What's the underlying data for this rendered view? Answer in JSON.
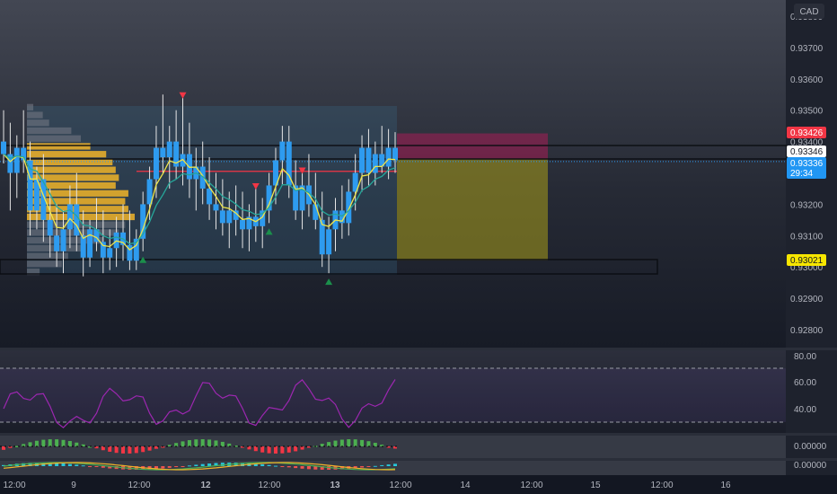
{
  "currency_badge": "CAD",
  "colors": {
    "bg_top": "#3a3e4a",
    "bg_bottom": "#131722",
    "candle": "#2e9bef",
    "wick": "#e6e6e6",
    "volume_profile": "#f0b429",
    "volume_profile_dim": "#787b86",
    "resistance_line": "#f23645",
    "short_stop_zone": "#c2185b",
    "short_target_zone": "#b5a51e",
    "ma_fast": "#f0e54a",
    "ma_slow": "#26a69a",
    "rsi_line": "#9c27b0",
    "tag_red": "#f23645",
    "tag_white": "#ffffff",
    "tag_blue": "#2962ff",
    "tag_yellow": "#f7e600"
  },
  "price_axis": {
    "ticks": [
      "0.93800",
      "0.93700",
      "0.93600",
      "0.93500",
      "0.93400",
      "0.93200",
      "0.93100",
      "0.93000",
      "0.92900",
      "0.92800"
    ]
  },
  "price_tags": [
    {
      "id": "stop",
      "label": "0.93426",
      "price": 0.93426,
      "style": "red"
    },
    {
      "id": "entry",
      "label": "0.93346",
      "price": 0.93346,
      "style": "white"
    },
    {
      "id": "last",
      "label": "0.93336",
      "sub": "29:34",
      "price": 0.93336,
      "style": "blue"
    },
    {
      "id": "target",
      "label": "0.93021",
      "price": 0.93021,
      "style": "yellow"
    }
  ],
  "rsi_axis": {
    "ticks": [
      "80.00",
      "60.00",
      "40.00"
    ]
  },
  "osc1_axis": {
    "ticks": [
      "0.00000"
    ]
  },
  "osc2_axis": {
    "ticks": [
      "0.00000"
    ]
  },
  "time_axis": {
    "labels": [
      "12:00",
      "9",
      "12:00",
      "12",
      "12:00",
      "13",
      "12:00",
      "14",
      "12:00",
      "15",
      "12:00",
      "16"
    ],
    "bold": [
      false,
      false,
      false,
      true,
      false,
      true,
      false,
      false,
      false,
      false,
      false,
      false
    ]
  },
  "chart_data": {
    "type": "candlestick",
    "ylim": [
      0.9275,
      0.9385
    ],
    "candles": [
      [
        0.934,
        0.935,
        0.9333,
        0.9336
      ],
      [
        0.9336,
        0.9346,
        0.9318,
        0.933
      ],
      [
        0.933,
        0.9342,
        0.9322,
        0.9338
      ],
      [
        0.9338,
        0.935,
        0.933,
        0.9334
      ],
      [
        0.9334,
        0.934,
        0.931,
        0.9318
      ],
      [
        0.9318,
        0.9332,
        0.9312,
        0.9328
      ],
      [
        0.9328,
        0.9336,
        0.9308,
        0.9315
      ],
      [
        0.9315,
        0.9325,
        0.9303,
        0.931
      ],
      [
        0.931,
        0.932,
        0.93,
        0.9305
      ],
      [
        0.9305,
        0.9318,
        0.9298,
        0.9312
      ],
      [
        0.9312,
        0.9326,
        0.9306,
        0.932
      ],
      [
        0.932,
        0.933,
        0.9305,
        0.931
      ],
      [
        0.931,
        0.9318,
        0.9297,
        0.9303
      ],
      [
        0.9303,
        0.9315,
        0.93,
        0.9312
      ],
      [
        0.9312,
        0.9322,
        0.9305,
        0.9308
      ],
      [
        0.9308,
        0.9318,
        0.9298,
        0.9303
      ],
      [
        0.9303,
        0.9312,
        0.9299,
        0.9306
      ],
      [
        0.9306,
        0.9316,
        0.93,
        0.9311
      ],
      [
        0.9311,
        0.932,
        0.9302,
        0.9307
      ],
      [
        0.9307,
        0.9318,
        0.9299,
        0.9302
      ],
      [
        0.9302,
        0.9312,
        0.9299,
        0.9309
      ],
      [
        0.9309,
        0.9324,
        0.9305,
        0.932
      ],
      [
        0.932,
        0.9332,
        0.9315,
        0.9328
      ],
      [
        0.9328,
        0.9345,
        0.9322,
        0.9338
      ],
      [
        0.9338,
        0.9355,
        0.933,
        0.9335
      ],
      [
        0.9335,
        0.9345,
        0.9325,
        0.934
      ],
      [
        0.934,
        0.935,
        0.9328,
        0.9332
      ],
      [
        0.9332,
        0.9354,
        0.9326,
        0.9336
      ],
      [
        0.9336,
        0.9346,
        0.9322,
        0.9328
      ],
      [
        0.9328,
        0.9338,
        0.9318,
        0.9332
      ],
      [
        0.9332,
        0.934,
        0.932,
        0.9325
      ],
      [
        0.9325,
        0.9335,
        0.9315,
        0.932
      ],
      [
        0.932,
        0.933,
        0.9312,
        0.9318
      ],
      [
        0.9318,
        0.9328,
        0.931,
        0.9314
      ],
      [
        0.9314,
        0.9324,
        0.9306,
        0.9318
      ],
      [
        0.9318,
        0.9326,
        0.931,
        0.9315
      ],
      [
        0.9315,
        0.9324,
        0.9306,
        0.9312
      ],
      [
        0.9312,
        0.932,
        0.9305,
        0.9316
      ],
      [
        0.9316,
        0.9325,
        0.9308,
        0.9313
      ],
      [
        0.9313,
        0.9322,
        0.9306,
        0.9318
      ],
      [
        0.9318,
        0.933,
        0.9314,
        0.9326
      ],
      [
        0.9326,
        0.9338,
        0.932,
        0.9334
      ],
      [
        0.9334,
        0.9345,
        0.9326,
        0.934
      ],
      [
        0.934,
        0.9345,
        0.9322,
        0.9326
      ],
      [
        0.9326,
        0.9334,
        0.9315,
        0.9318
      ],
      [
        0.9318,
        0.933,
        0.9312,
        0.9326
      ],
      [
        0.9326,
        0.9336,
        0.9316,
        0.932
      ],
      [
        0.932,
        0.933,
        0.9312,
        0.9315
      ],
      [
        0.9315,
        0.9324,
        0.93,
        0.9304
      ],
      [
        0.9304,
        0.9316,
        0.9298,
        0.9312
      ],
      [
        0.9312,
        0.9322,
        0.9305,
        0.9318
      ],
      [
        0.9318,
        0.9326,
        0.9309,
        0.9314
      ],
      [
        0.9314,
        0.9328,
        0.931,
        0.9324
      ],
      [
        0.9324,
        0.9336,
        0.9318,
        0.933
      ],
      [
        0.933,
        0.9342,
        0.9324,
        0.9338
      ],
      [
        0.9338,
        0.9344,
        0.9326,
        0.933
      ],
      [
        0.933,
        0.934,
        0.9326,
        0.9336
      ],
      [
        0.9336,
        0.9345,
        0.933,
        0.9332
      ],
      [
        0.9332,
        0.9344,
        0.9328,
        0.9338
      ],
      [
        0.9338,
        0.9343,
        0.933,
        0.9334
      ]
    ],
    "resistance_price": 0.93346,
    "stop_price": 0.93426,
    "target_price": 0.93021
  }
}
